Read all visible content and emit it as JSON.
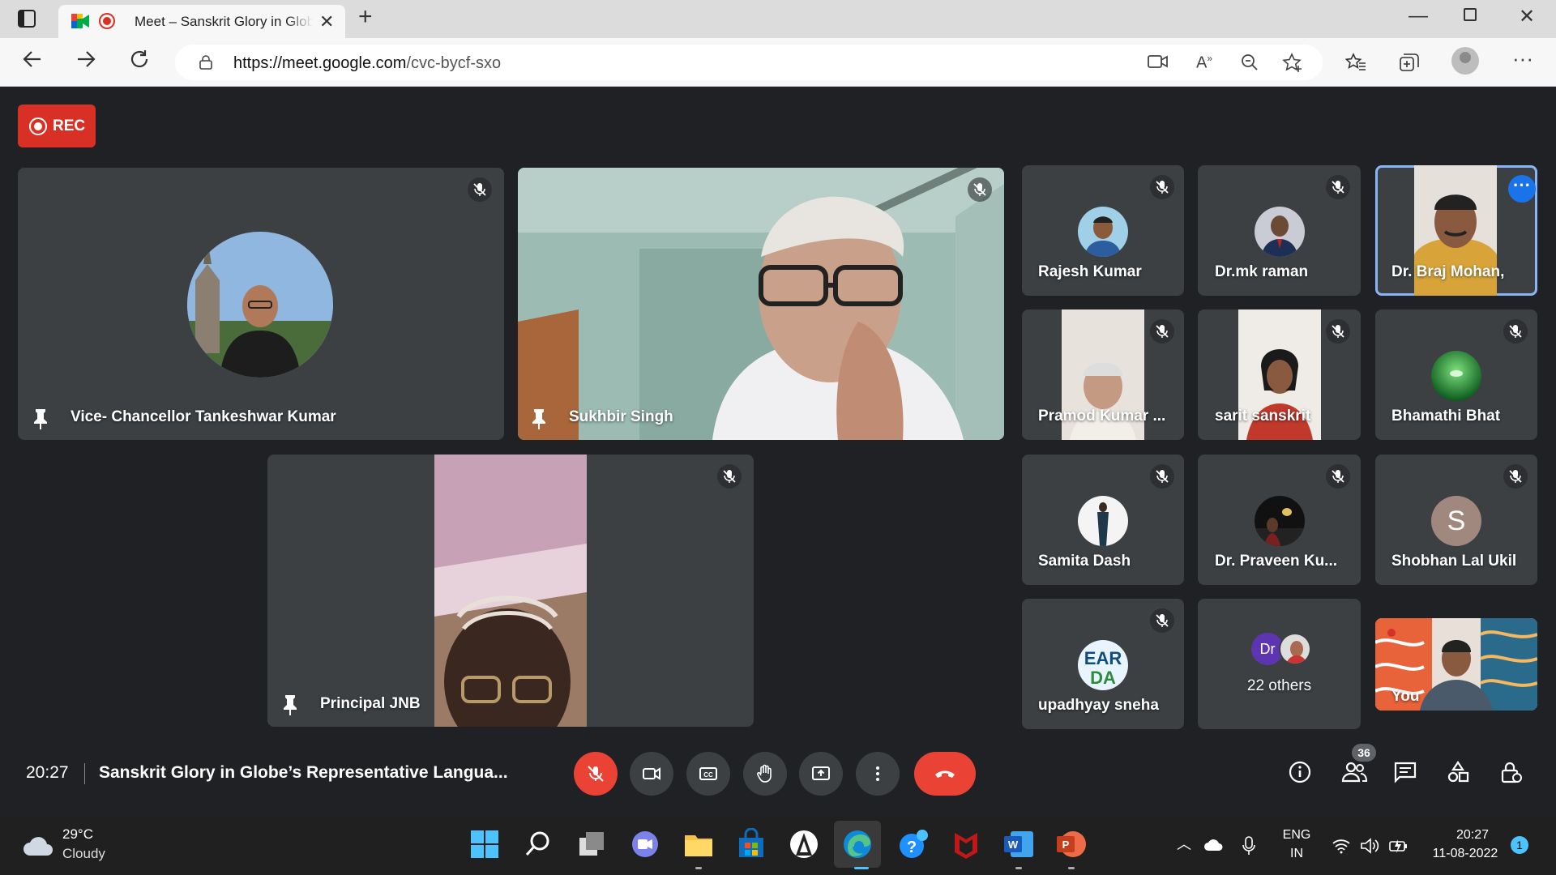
{
  "browser": {
    "tab_title": "Meet – Sanskrit Glory in Globe’s Representative Language",
    "url_host": "https://meet.google.com",
    "url_path": "/cvc-bycf-sxo",
    "new_tab_icon": "plus-icon",
    "minimize_icon": "minimize-icon",
    "maximize_icon": "restore-icon",
    "close_icon": "close-icon"
  },
  "recording": {
    "label": "REC",
    "color": "#d93025"
  },
  "tiles": {
    "vc": {
      "name": "Vice- Chancellor Tankeshwar Kumar"
    },
    "sukhbir": {
      "name": "Sukhbir Singh"
    },
    "principal": {
      "name": "Principal JNB"
    },
    "rajesh": {
      "name": "Rajesh Kumar"
    },
    "mkraman": {
      "name": "Dr.mk raman"
    },
    "brajmohan": {
      "name": "Dr. Braj Mohan,"
    },
    "pramod": {
      "name": "Pramod Kumar ..."
    },
    "sarit": {
      "name": "sarit sanskrit"
    },
    "bhamathi": {
      "name": "Bhamathi Bhat"
    },
    "samita": {
      "name": "Samita Dash"
    },
    "praveen": {
      "name": "Dr. Praveen Ku..."
    },
    "shobhan": {
      "name": "Shobhan Lal Ukil",
      "initial": "S"
    },
    "upadhyay": {
      "name": "upadhyay sneha"
    },
    "others": {
      "label": "22 others",
      "badge": "Dr"
    },
    "you": {
      "name": "You"
    }
  },
  "meeting": {
    "time": "20:27",
    "title": "Sanskrit Glory in Globe’s Representative Langua...",
    "participant_count": "36"
  },
  "taskbar": {
    "weather_temp": "29°C",
    "weather_desc": "Cloudy",
    "lang_top": "ENG",
    "lang_bottom": "IN",
    "time": "20:27",
    "date": "11-08-2022",
    "notifications": "1"
  },
  "colors": {
    "meet_bg": "#202124",
    "tile_bg": "#3c4043",
    "end_call": "#ea4335",
    "active_speaker": "#8ab4f8"
  }
}
